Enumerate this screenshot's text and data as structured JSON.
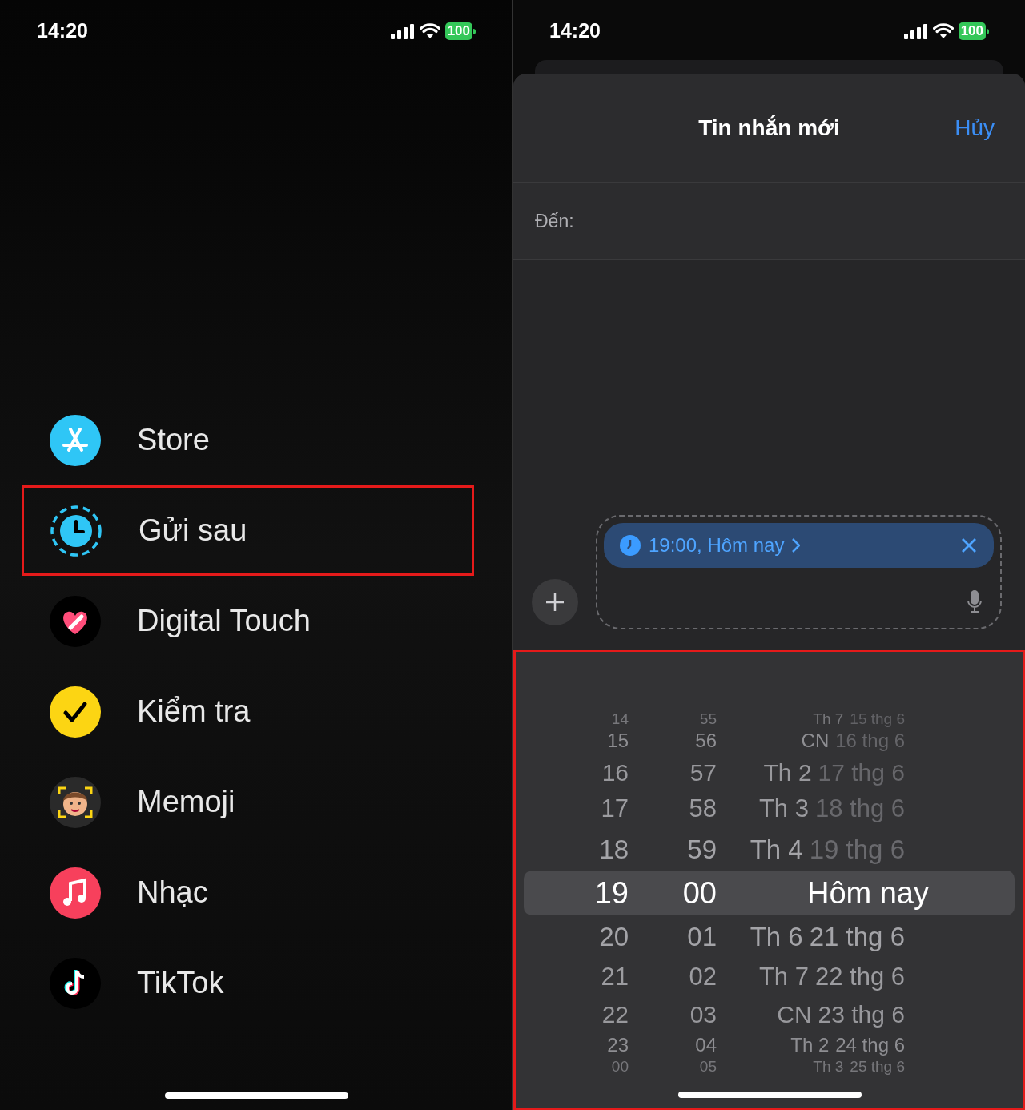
{
  "left_screen": {
    "status_bar": {
      "time": "14:20",
      "battery": "100"
    },
    "menu_items": [
      {
        "kind": "store",
        "label": "Store",
        "highlighted": false
      },
      {
        "kind": "schedule",
        "label": "Gửi sau",
        "highlighted": true
      },
      {
        "kind": "touch",
        "label": "Digital Touch",
        "highlighted": false
      },
      {
        "kind": "check",
        "label": "Kiểm tra",
        "highlighted": false
      },
      {
        "kind": "memoji",
        "label": "Memoji",
        "highlighted": false
      },
      {
        "kind": "music",
        "label": "Nhạc",
        "highlighted": false
      },
      {
        "kind": "tiktok",
        "label": "TikTok",
        "highlighted": false
      }
    ]
  },
  "right_screen": {
    "status_bar": {
      "time": "14:20",
      "battery": "100"
    },
    "sheet": {
      "title": "Tin nhắn mới",
      "cancel": "Hủy",
      "to_label": "Đến:"
    },
    "compose": {
      "schedule_chip": "19:00, Hôm nay"
    },
    "picker": {
      "highlighted": true,
      "rows": [
        {
          "hour": "14",
          "minute": "55",
          "weekday": "Th 7",
          "date": "15 thg 6",
          "selected": false,
          "date_dimmed": true
        },
        {
          "hour": "15",
          "minute": "56",
          "weekday": "CN",
          "date": "16 thg 6",
          "selected": false,
          "date_dimmed": true
        },
        {
          "hour": "16",
          "minute": "57",
          "weekday": "Th 2",
          "date": "17 thg 6",
          "selected": false,
          "date_dimmed": true
        },
        {
          "hour": "17",
          "minute": "58",
          "weekday": "Th 3",
          "date": "18 thg 6",
          "selected": false,
          "date_dimmed": true
        },
        {
          "hour": "18",
          "minute": "59",
          "weekday": "Th 4",
          "date": "19 thg 6",
          "selected": false,
          "date_dimmed": true
        },
        {
          "hour": "19",
          "minute": "00",
          "weekday": "",
          "date": "Hôm nay",
          "selected": true,
          "date_dimmed": false
        },
        {
          "hour": "20",
          "minute": "01",
          "weekday": "Th 6",
          "date": "21 thg 6",
          "selected": false,
          "date_dimmed": false
        },
        {
          "hour": "21",
          "minute": "02",
          "weekday": "Th 7",
          "date": "22 thg 6",
          "selected": false,
          "date_dimmed": false
        },
        {
          "hour": "22",
          "minute": "03",
          "weekday": "CN",
          "date": "23 thg 6",
          "selected": false,
          "date_dimmed": false
        },
        {
          "hour": "23",
          "minute": "04",
          "weekday": "Th 2",
          "date": "24 thg 6",
          "selected": false,
          "date_dimmed": false
        },
        {
          "hour": "00",
          "minute": "05",
          "weekday": "Th 3",
          "date": "25 thg 6",
          "selected": false,
          "date_dimmed": false
        }
      ]
    }
  }
}
